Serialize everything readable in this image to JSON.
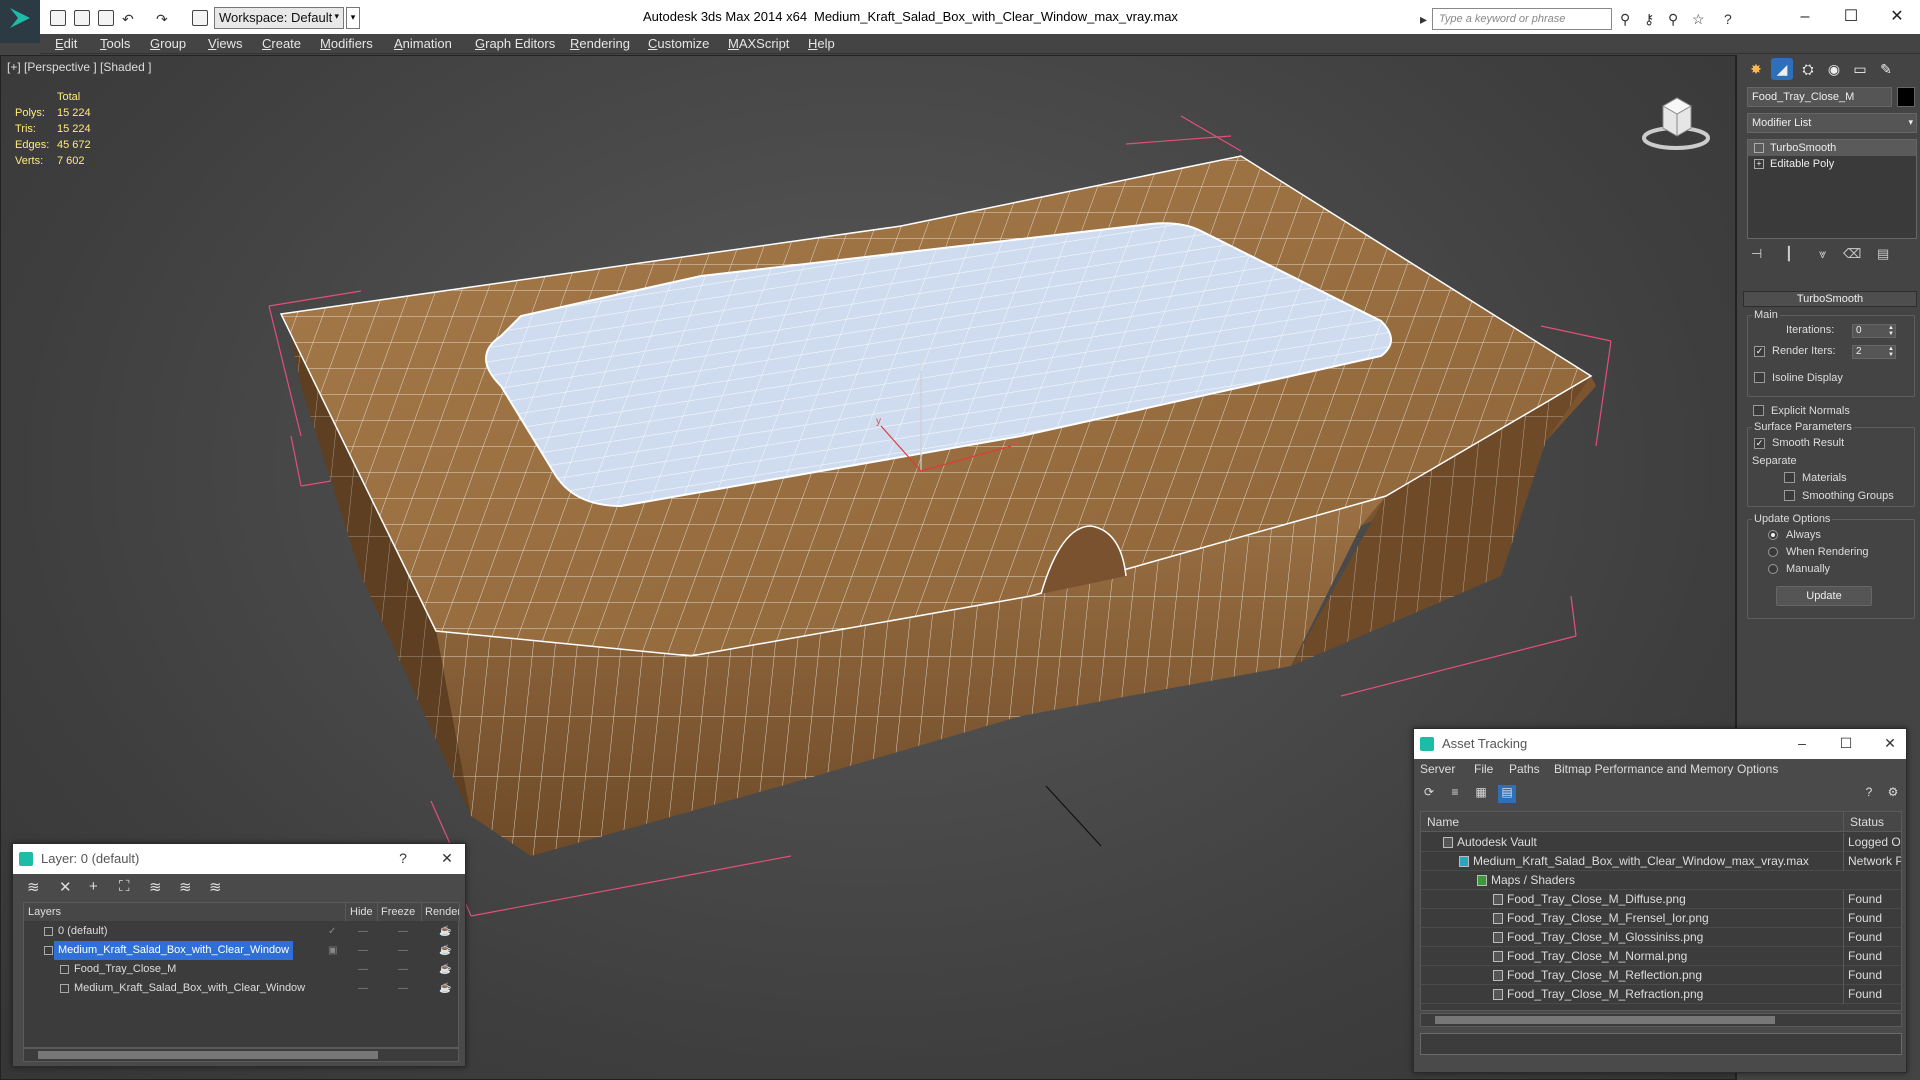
{
  "titlebar": {
    "workspace": "Workspace: Default",
    "app": "Autodesk 3ds Max  2014 x64",
    "file": "Medium_Kraft_Salad_Box_with_Clear_Window_max_vray.max",
    "search_placeholder": "Type a keyword or phrase"
  },
  "menu": [
    "Edit",
    "Tools",
    "Group",
    "Views",
    "Create",
    "Modifiers",
    "Animation",
    "Graph Editors",
    "Rendering",
    "Customize",
    "MAXScript",
    "Help"
  ],
  "viewport": {
    "label": "[+] [Perspective ] [Shaded ]",
    "stats": {
      "header": "Total",
      "rows": [
        {
          "k": "Polys:",
          "v": "15 224"
        },
        {
          "k": "Tris:",
          "v": "15 224"
        },
        {
          "k": "Edges:",
          "v": "45 672"
        },
        {
          "k": "Verts:",
          "v": "7 602"
        }
      ]
    },
    "axis": {
      "x": "x",
      "y": "y",
      "z": "z"
    }
  },
  "command_panel": {
    "object_name": "Food_Tray_Close_M",
    "modifier_list": "Modifier List",
    "stack": [
      "TurboSmooth",
      "Editable Poly"
    ],
    "rollout": "TurboSmooth",
    "main_group": "Main",
    "iterations_label": "Iterations:",
    "iterations_value": "0",
    "render_iters_label": "Render Iters:",
    "render_iters_value": "2",
    "isoline": "Isoline Display",
    "explicit_normals": "Explicit Normals",
    "surface_group": "Surface Parameters",
    "smooth_result": "Smooth Result",
    "separate": "Separate",
    "materials": "Materials",
    "smoothing_groups": "Smoothing Groups",
    "update_group": "Update Options",
    "always": "Always",
    "when_rendering": "When Rendering",
    "manually": "Manually",
    "update_button": "Update"
  },
  "layer_window": {
    "title": "Layer: 0 (default)",
    "help": "?",
    "columns": [
      "Layers",
      "Hide",
      "Freeze",
      "Render"
    ],
    "rows": [
      {
        "name": "0 (default)"
      },
      {
        "name": "Medium_Kraft_Salad_Box_with_Clear_Window"
      },
      {
        "name": "Food_Tray_Close_M"
      },
      {
        "name": "Medium_Kraft_Salad_Box_with_Clear_Window"
      }
    ]
  },
  "asset_window": {
    "title": "Asset Tracking",
    "menu": [
      "Server",
      "File",
      "Paths",
      "Bitmap Performance and Memory",
      "Options"
    ],
    "columns": [
      "Name",
      "Status"
    ],
    "rows": [
      {
        "name": "Autodesk Vault",
        "status": "Logged Out"
      },
      {
        "name": "Medium_Kraft_Salad_Box_with_Clear_Window_max_vray.max",
        "status": "Network Path"
      },
      {
        "name": "Maps / Shaders",
        "status": ""
      },
      {
        "name": "Food_Tray_Close_M_Diffuse.png",
        "status": "Found"
      },
      {
        "name": "Food_Tray_Close_M_Frensel_Ior.png",
        "status": "Found"
      },
      {
        "name": "Food_Tray_Close_M_Glossiniss.png",
        "status": "Found"
      },
      {
        "name": "Food_Tray_Close_M_Normal.png",
        "status": "Found"
      },
      {
        "name": "Food_Tray_Close_M_Reflection.png",
        "status": "Found"
      },
      {
        "name": "Food_Tray_Close_M_Refraction.png",
        "status": "Found"
      }
    ]
  }
}
